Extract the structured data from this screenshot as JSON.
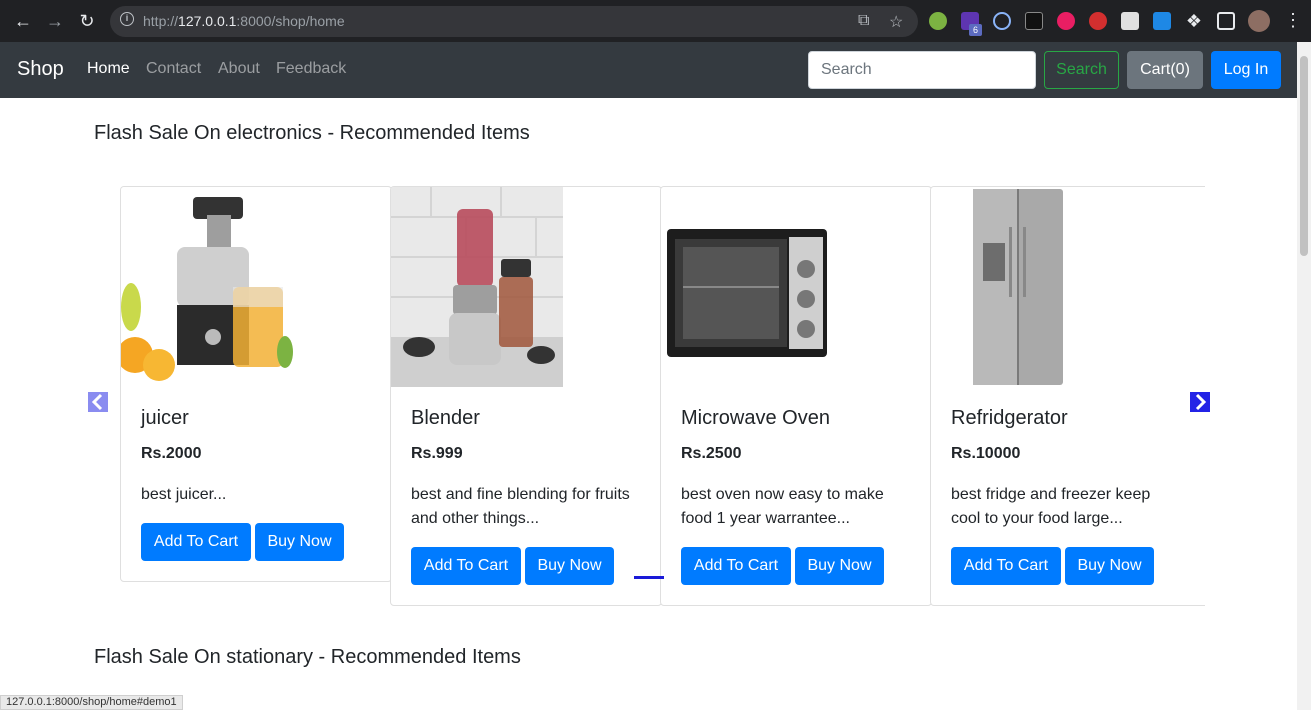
{
  "browser": {
    "url_scheme": "http://",
    "url_host": "127.0.0.1",
    "url_rest": ":8000/shop/home",
    "extension_badge": "6",
    "status_url": "127.0.0.1:8000/shop/home#demo1"
  },
  "navbar": {
    "brand": "Shop",
    "links": [
      "Home",
      "Contact",
      "About",
      "Feedback"
    ],
    "search_placeholder": "Search",
    "search_button": "Search",
    "cart_button": "Cart(0)",
    "login_button": "Log In"
  },
  "sections": [
    {
      "heading": "Flash Sale On electronics - Recommended Items",
      "products": [
        {
          "name": "juicer",
          "price": "Rs.2000",
          "description": "best juicer...",
          "add_label": "Add To Cart",
          "buy_label": "Buy Now"
        },
        {
          "name": "Blender",
          "price": "Rs.999",
          "description": "best and fine blending for fruits and other things...",
          "add_label": "Add To Cart",
          "buy_label": "Buy Now"
        },
        {
          "name": "Microwave Oven",
          "price": "Rs.2500",
          "description": "best oven now easy to make food 1 year warrantee...",
          "add_label": "Add To Cart",
          "buy_label": "Buy Now"
        },
        {
          "name": "Refridgerator",
          "price": "Rs.10000",
          "description": "best fridge and freezer keep cool to your food large...",
          "add_label": "Add To Cart",
          "buy_label": "Buy Now"
        }
      ]
    },
    {
      "heading": "Flash Sale On stationary - Recommended Items"
    }
  ],
  "colors": {
    "primary": "#007bff",
    "navbar_bg": "#343a40",
    "success": "#28a745",
    "secondary": "#6c757d"
  }
}
